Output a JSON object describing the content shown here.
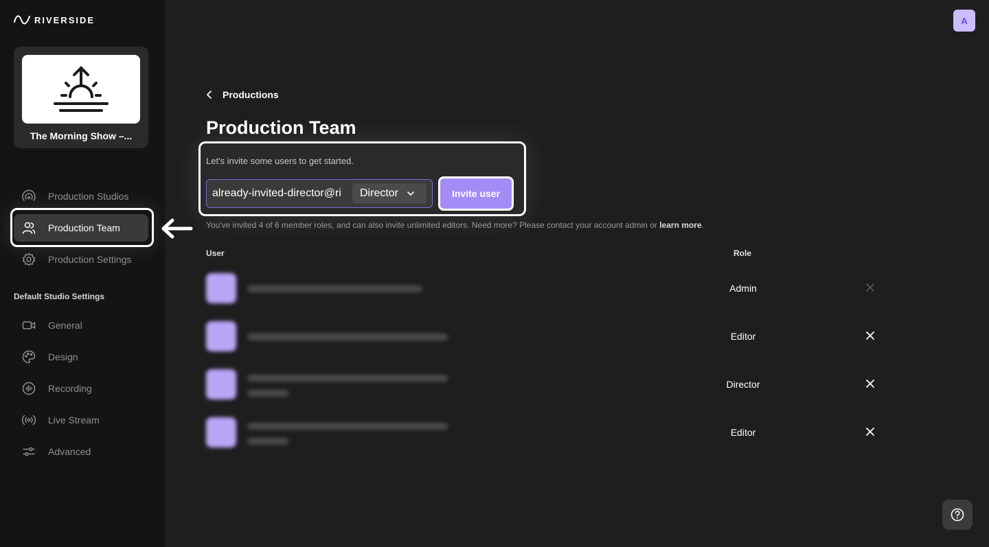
{
  "brand": {
    "name": "RIVERSIDE"
  },
  "show": {
    "title": "The Morning Show –..."
  },
  "sidebar": {
    "items": [
      {
        "label": "Production Studios",
        "icon": "studio-icon"
      },
      {
        "label": "Production Team",
        "icon": "team-icon",
        "active": true
      },
      {
        "label": "Production Settings",
        "icon": "gear-icon"
      }
    ],
    "section_label": "Default Studio Settings",
    "settings": [
      {
        "label": "General",
        "icon": "camera-icon"
      },
      {
        "label": "Design",
        "icon": "palette-icon"
      },
      {
        "label": "Recording",
        "icon": "recording-icon"
      },
      {
        "label": "Live Stream",
        "icon": "broadcast-icon"
      },
      {
        "label": "Advanced",
        "icon": "sliders-icon"
      }
    ]
  },
  "header": {
    "avatar_initial": "A"
  },
  "main": {
    "back_label": "Productions",
    "title": "Production Team",
    "invite": {
      "hint": "Let's invite some users to get started.",
      "email_value": "already-invited-director@ri",
      "role_selected": "Director",
      "button_label": "Invite user",
      "info_text": "You've invited 4 of 6 member roles, and can also invite unlimited editors. Need more? Please contact your account admin or ",
      "info_link": "learn more",
      "info_end": "."
    },
    "table": {
      "columns": [
        "User",
        "Role"
      ],
      "rows": [
        {
          "role": "Admin"
        },
        {
          "role": "Editor"
        },
        {
          "role": "Director"
        },
        {
          "role": "Editor"
        }
      ]
    }
  },
  "colors": {
    "accent": "#a48cf6",
    "background": "#1e1e1e",
    "sidebar": "#141414"
  }
}
